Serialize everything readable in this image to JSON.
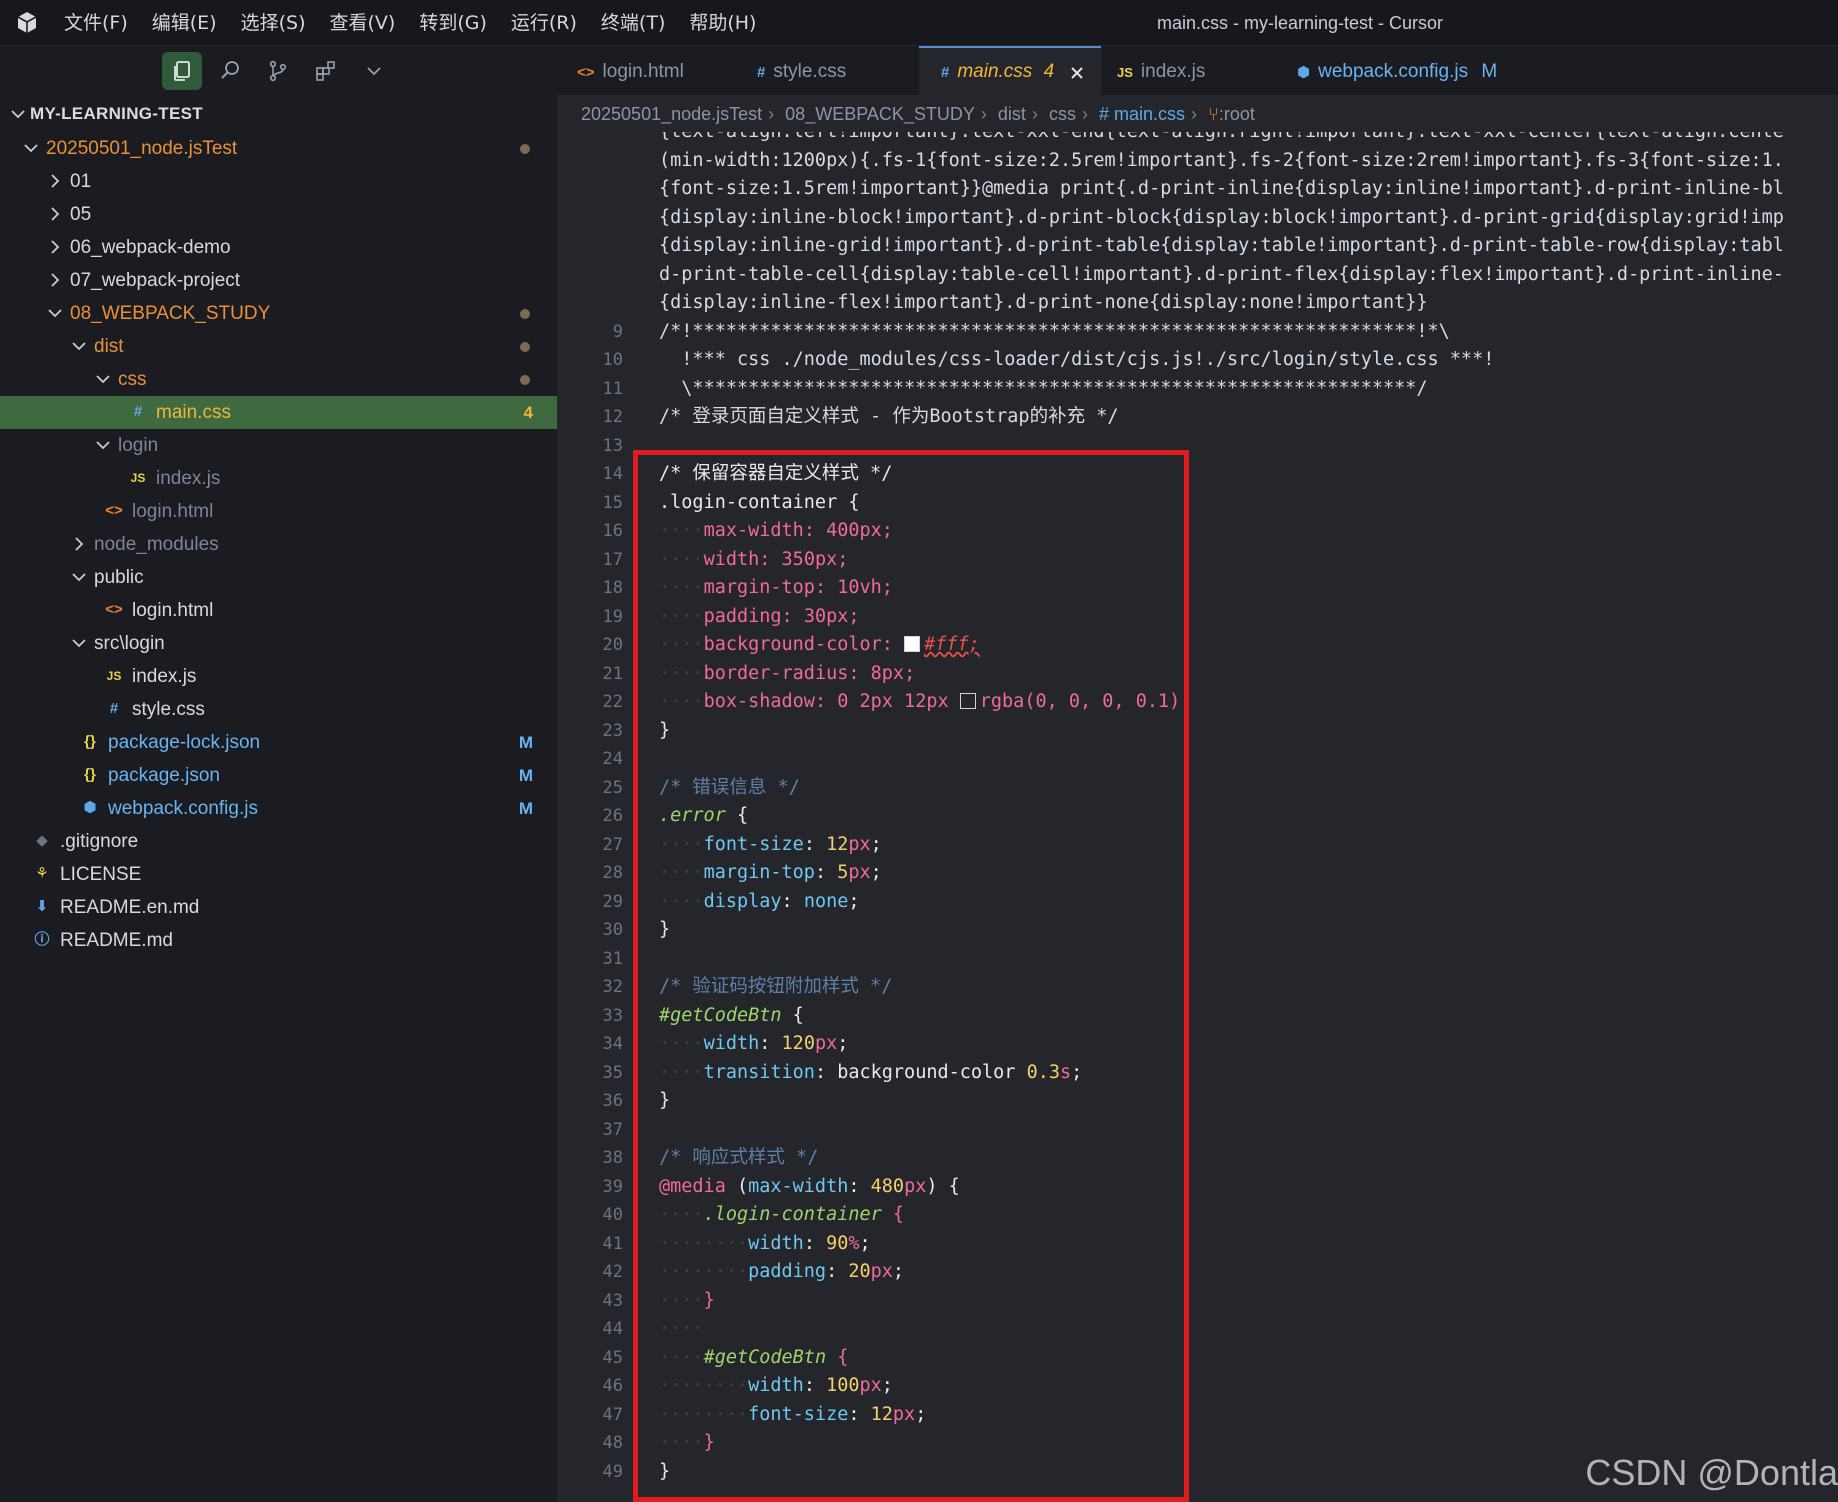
{
  "titlebar": {
    "menu": [
      "文件(F)",
      "编辑(E)",
      "选择(S)",
      "查看(V)",
      "转到(G)",
      "运行(R)",
      "终端(T)",
      "帮助(H)"
    ],
    "window_title": "main.css - my-learning-test - Cursor"
  },
  "activitybar": {
    "icons": [
      "files-icon",
      "search-icon",
      "source-control-icon",
      "extensions-icon",
      "chevron-down-icon"
    ]
  },
  "sidebar": {
    "project": "MY-LEARNING-TEST",
    "tree": [
      {
        "label": "20250501_node.jsTest",
        "color": "#e8913a",
        "dot": true
      },
      {
        "label": "01",
        "color": "#d6d9df"
      },
      {
        "label": "05",
        "color": "#d6d9df"
      },
      {
        "label": "06_webpack-demo",
        "color": "#d6d9df"
      },
      {
        "label": "07_webpack-project",
        "color": "#d6d9df"
      },
      {
        "label": "08_WEBPACK_STUDY",
        "color": "#e8913a",
        "dot": true
      },
      {
        "label": "dist",
        "color": "#e8913a",
        "dot": true
      },
      {
        "label": "css",
        "color": "#e8913a",
        "dot": true
      },
      {
        "label": "main.css",
        "color": "#f0b53a",
        "badge": "4",
        "icon": "#"
      },
      {
        "label": "login",
        "color": "#7d8494"
      },
      {
        "label": "index.js",
        "color": "#7d8494",
        "icon": "JS"
      },
      {
        "label": "login.html",
        "color": "#7d8494",
        "icon": "<>"
      },
      {
        "label": "node_modules",
        "color": "#7d8494"
      },
      {
        "label": "public",
        "color": "#d6d9df"
      },
      {
        "label": "login.html",
        "color": "#d6d9df",
        "icon": "<>"
      },
      {
        "label": "src\\login",
        "color": "#d6d9df"
      },
      {
        "label": "index.js",
        "color": "#d6d9df",
        "icon": "JS"
      },
      {
        "label": "style.css",
        "color": "#d6d9df",
        "icon": "#"
      },
      {
        "label": "package-lock.json",
        "color": "#69b3f0",
        "badge": "M",
        "icon": "{}"
      },
      {
        "label": "package.json",
        "color": "#69b3f0",
        "badge": "M",
        "icon": "{}"
      },
      {
        "label": "webpack.config.js",
        "color": "#69b3f0",
        "badge": "M",
        "icon": "cube"
      },
      {
        "label": ".gitignore",
        "color": "#d6d9df",
        "icon": "git"
      },
      {
        "label": "LICENSE",
        "color": "#d6d9df",
        "icon": "license"
      },
      {
        "label": "README.en.md",
        "color": "#d6d9df",
        "icon": "md"
      },
      {
        "label": "README.md",
        "color": "#d6d9df",
        "icon": "info"
      }
    ]
  },
  "tabs": [
    {
      "label": "login.html",
      "icon": "<>"
    },
    {
      "label": "style.css",
      "icon": "#"
    },
    {
      "label": "main.css",
      "icon": "#",
      "badge": "4"
    },
    {
      "label": "index.js",
      "icon": "JS"
    },
    {
      "label": "webpack.config.js",
      "icon": "cube",
      "badge": "M"
    }
  ],
  "breadcrumb": [
    "20250501_node.jsTest",
    "08_WEBPACK_STUDY",
    "dist",
    "css",
    "# main.css",
    ":root"
  ],
  "editor": {
    "wrapped_lines": [
      "{text-align:left!important}.text-xxl-end{text-align:right!important}.text-xxl-center{text-align:cente",
      "(min-width:1200px){.fs-1{font-size:2.5rem!important}.fs-2{font-size:2rem!important}.fs-3{font-size:1.",
      "{font-size:1.5rem!important}}@media print{.d-print-inline{display:inline!important}.d-print-inline-bl",
      "{display:inline-block!important}.d-print-block{display:block!important}.d-print-grid{display:grid!imp",
      "{display:inline-grid!important}.d-print-table{display:table!important}.d-print-table-row{display:tabl",
      "d-print-table-cell{display:table-cell!important}.d-print-flex{display:flex!important}.d-print-inline-",
      "{display:inline-flex!important}.d-print-none{display:none!important}}"
    ],
    "line_numbers": [
      "9",
      "10",
      "11",
      "12",
      "13",
      "14",
      "15",
      "16",
      "17",
      "18",
      "19",
      "20",
      "21",
      "22",
      "23",
      "24",
      "25",
      "26",
      "27",
      "28",
      "29",
      "30",
      "31",
      "32",
      "33",
      "34",
      "35",
      "36",
      "37",
      "38",
      "39",
      "40",
      "41",
      "42",
      "43",
      "44",
      "45",
      "46",
      "47",
      "48",
      "49"
    ],
    "line9": "/*!*****************************************************************!*\\",
    "line10": "  !*** css ./node_modules/css-loader/dist/cjs.js!./src/login/style.css ***!",
    "line11": "  \\*****************************************************************/",
    "line12": "/* 登录页面自定义样式 - 作为Bootstrap的补充 */",
    "line14": "/* 保留容器自定义样式 */",
    "line15": ".login-container {",
    "line16": {
      "prop": "max-width",
      "num": "400",
      "unit": "px"
    },
    "line17": {
      "prop": "width",
      "num": "350",
      "unit": "px"
    },
    "line18": {
      "prop": "margin-top",
      "num": "10",
      "unit": "vh"
    },
    "line19": {
      "prop": "padding",
      "num": "30",
      "unit": "px"
    },
    "line20": {
      "prop": "background-color",
      "value": "#fff;"
    },
    "line21": {
      "prop": "border-radius",
      "num": "8",
      "unit": "px"
    },
    "line22": {
      "prop": "box-shadow",
      "value": "0 2px 12px",
      "rgba": "rgba(0, 0, 0, 0.1);"
    },
    "line25": "/* 错误信息 */",
    "line26": ".error",
    "line27": {
      "prop": "font-size",
      "num": "12",
      "unit": "px"
    },
    "line28": {
      "prop": "margin-top",
      "num": "5",
      "unit": "px"
    },
    "line29": {
      "prop": "display",
      "value": "none"
    },
    "line32": "/* 验证码按钮附加样式 */",
    "line33": "#getCodeBtn",
    "line34": {
      "prop": "width",
      "num": "120",
      "unit": "px"
    },
    "line35": {
      "prop": "transition",
      "value": "background-color",
      "num": "0.3",
      "unit": "s"
    },
    "line38": "/* 响应式样式 */",
    "line39": {
      "at": "@media",
      "prop": "max-width",
      "num": "480",
      "unit": "px"
    },
    "line40": ".login-container",
    "line41": {
      "prop": "width",
      "num": "90",
      "unit": "%"
    },
    "line42": {
      "prop": "padding",
      "num": "20",
      "unit": "px"
    },
    "line45": "#getCodeBtn",
    "line46": {
      "prop": "width",
      "num": "100",
      "unit": "px"
    },
    "line47": {
      "prop": "font-size",
      "num": "12",
      "unit": "px"
    }
  },
  "watermark": "CSDN @Dontla",
  "colors": {
    "accent": "#5a8dd6",
    "highlight_box": "#e01c1c",
    "selected_row": "#3f6a3f"
  }
}
